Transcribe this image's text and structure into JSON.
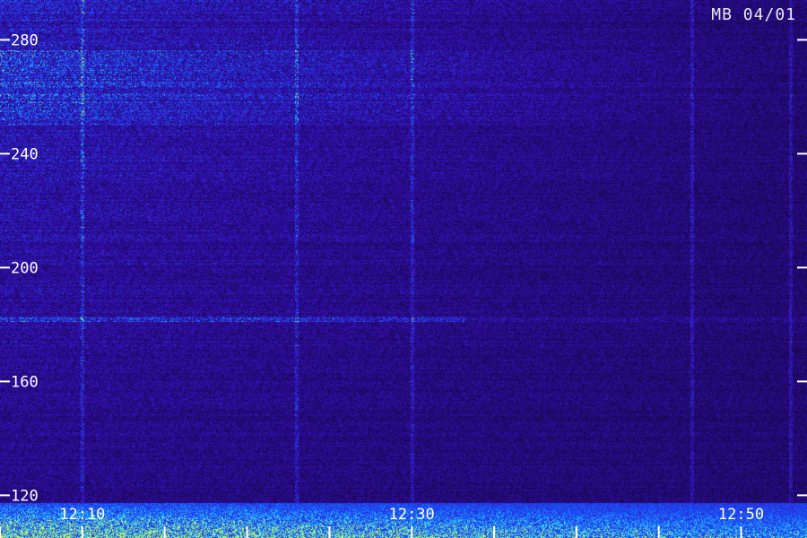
{
  "chart_data": {
    "type": "heatmap",
    "title": "",
    "station_label": "MB 04/01",
    "xlabel": "",
    "ylabel": "",
    "x_time_range": [
      "12:05",
      "12:54"
    ],
    "x_tick_labels": [
      "12:10",
      "12:30",
      "12:50"
    ],
    "x_minor_tick_times": [
      "12:05",
      "12:10",
      "12:15",
      "12:20",
      "12:25",
      "12:30",
      "12:35",
      "12:40",
      "12:45",
      "12:50",
      "12:55"
    ],
    "ylim": [
      105,
      294
    ],
    "y_ticks": [
      120,
      160,
      200,
      240,
      280
    ],
    "y_tick_labels": [
      "120",
      "160",
      "200",
      "240",
      "280"
    ],
    "colormap": [
      "#0a0420",
      "#3a10c8",
      "#1060ff",
      "#30e0ff",
      "#c0ff60"
    ],
    "features": {
      "horizontal_band_y": 182,
      "vertical_streaks_time": [
        "12:10",
        "12:23",
        "12:30",
        "12:47",
        "12:53"
      ]
    }
  }
}
